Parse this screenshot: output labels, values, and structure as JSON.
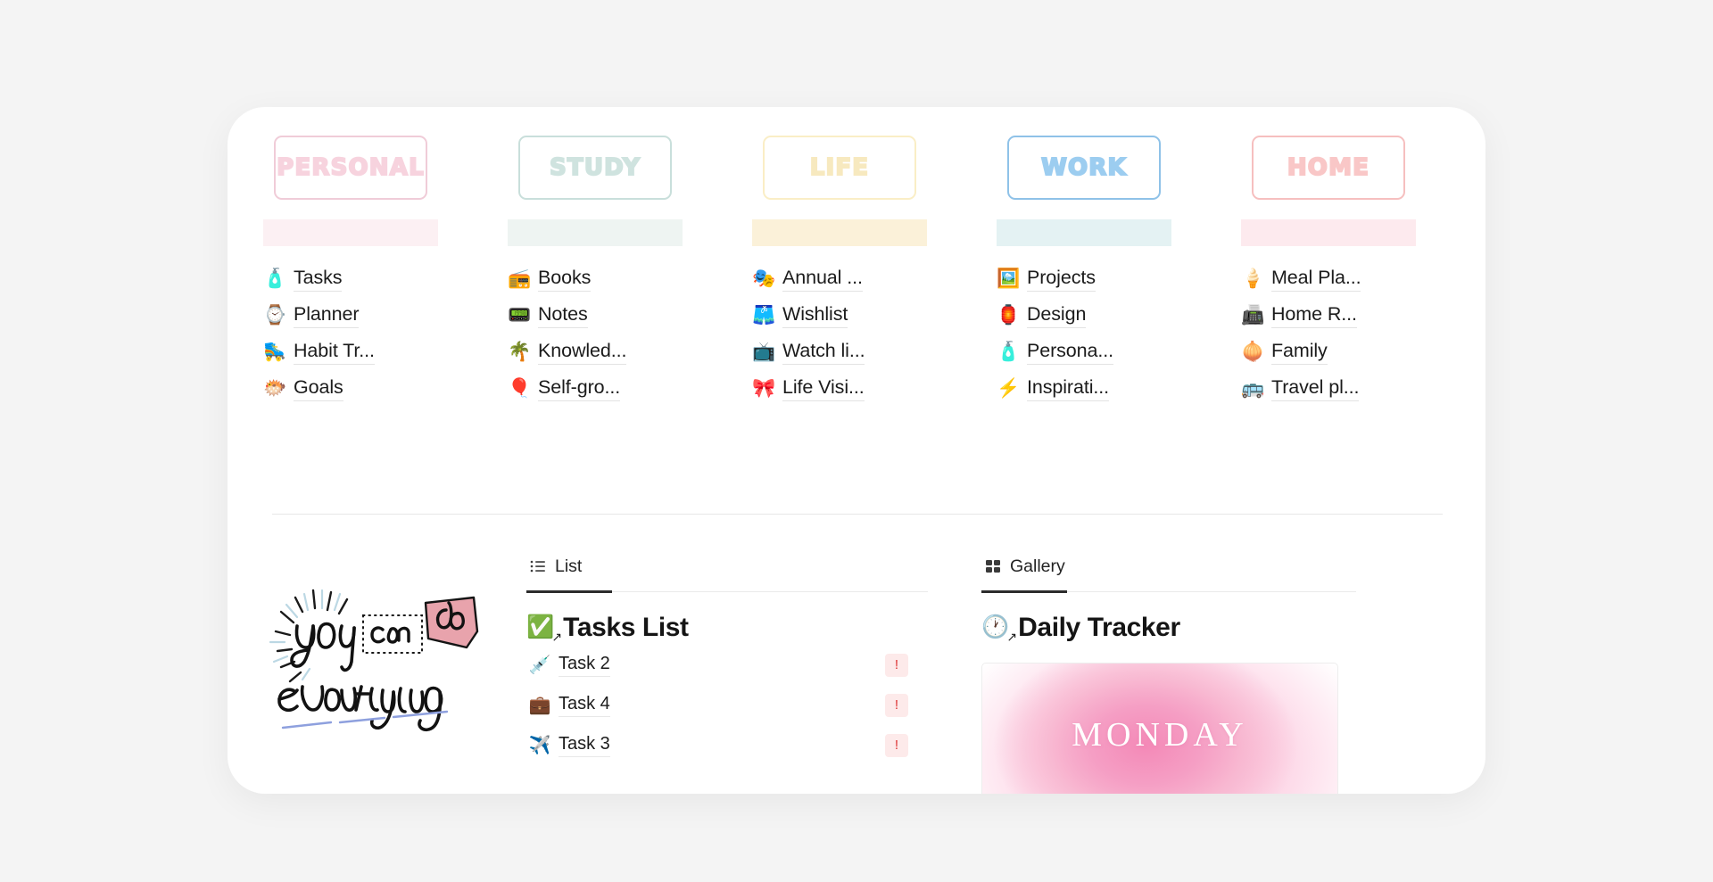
{
  "page": {
    "background_color": "#f4f4f4",
    "card_background": "#ffffff"
  },
  "categories": [
    {
      "id": "personal",
      "badge_label": "PERSONAL",
      "border_color": "#f0ccd8",
      "text_color": "#f7d3de",
      "band_color": "#fcf0f3",
      "items": [
        {
          "emoji": "🧴",
          "icon_name": "spray-bottle-icon",
          "label": "Tasks"
        },
        {
          "emoji": "⌚",
          "icon_name": "watch-icon",
          "label": "Planner"
        },
        {
          "emoji": "🛼",
          "icon_name": "roller-skate-icon",
          "label": "Habit Tr..."
        },
        {
          "emoji": "🐡",
          "icon_name": "blowfish-icon",
          "label": "Goals"
        }
      ]
    },
    {
      "id": "study",
      "badge_label": "STUDY",
      "border_color": "#c9dfdb",
      "text_color": "#cfe3df",
      "band_color": "#eef4f2",
      "items": [
        {
          "emoji": "📻",
          "icon_name": "radio-icon",
          "label": "Books"
        },
        {
          "emoji": "📟",
          "icon_name": "pager-icon",
          "label": "Notes"
        },
        {
          "emoji": "🌴",
          "icon_name": "palm-tree-icon",
          "label": "Knowled..."
        },
        {
          "emoji": "🎈",
          "icon_name": "balloon-icon",
          "label": "Self-gro..."
        }
      ]
    },
    {
      "id": "life",
      "badge_label": "LIFE",
      "border_color": "#faeec6",
      "text_color": "#f7e9bf",
      "band_color": "#fbf1d9",
      "items": [
        {
          "emoji": "🎭",
          "icon_name": "mask-icon",
          "label": "Annual ..."
        },
        {
          "emoji": "🩳",
          "icon_name": "shorts-icon",
          "label": "Wishlist"
        },
        {
          "emoji": "📺",
          "icon_name": "television-icon",
          "label": "Watch li..."
        },
        {
          "emoji": "🎀",
          "icon_name": "ribbon-icon",
          "label": "Life Visi..."
        }
      ]
    },
    {
      "id": "work",
      "badge_label": "WORK",
      "border_color": "#8fc2e8",
      "text_color": "#9ccdf0",
      "band_color": "#e4f2f3",
      "items": [
        {
          "emoji": "🖼️",
          "icon_name": "framed-picture-icon",
          "label": "Projects"
        },
        {
          "emoji": "🏮",
          "icon_name": "lantern-icon",
          "label": "Design"
        },
        {
          "emoji": "🧴",
          "icon_name": "lotion-bottle-icon",
          "label": "Persona..."
        },
        {
          "emoji": "⚡",
          "icon_name": "lightning-icon",
          "label": "Inspirati..."
        }
      ]
    },
    {
      "id": "home",
      "badge_label": "HOME",
      "border_color": "#f6bfbf",
      "text_color": "#f9c7c7",
      "band_color": "#fdeaee",
      "items": [
        {
          "emoji": "🍦",
          "icon_name": "ice-cream-icon",
          "label": "Meal Pla..."
        },
        {
          "emoji": "📠",
          "icon_name": "fax-machine-icon",
          "label": "Home R..."
        },
        {
          "emoji": "🧅",
          "icon_name": "onion-icon",
          "label": "Family"
        },
        {
          "emoji": "🚌",
          "icon_name": "bus-icon",
          "label": "Travel pl..."
        }
      ]
    }
  ],
  "lettering": {
    "line1_word1": "you",
    "line1_word2": "can",
    "line1_word3": "do",
    "line2": "everything"
  },
  "list_panel": {
    "tab_label": "List",
    "tab_icon": "list-view-icon",
    "title": "Tasks List",
    "title_emoji": "✅",
    "title_icon_name": "check-badge-icon",
    "tasks": [
      {
        "emoji": "💉",
        "icon_name": "syringe-icon",
        "label": "Task 2",
        "priority": "!"
      },
      {
        "emoji": "💼",
        "icon_name": "briefcase-icon",
        "label": "Task 4",
        "priority": "!"
      },
      {
        "emoji": "✈️",
        "icon_name": "airplane-icon",
        "label": "Task 3",
        "priority": "!"
      }
    ]
  },
  "gallery_panel": {
    "tab_label": "Gallery",
    "tab_icon": "gallery-view-icon",
    "title": "Daily Tracker",
    "title_emoji": "🕐",
    "title_icon_name": "clock-icon",
    "card_label": "MONDAY"
  }
}
